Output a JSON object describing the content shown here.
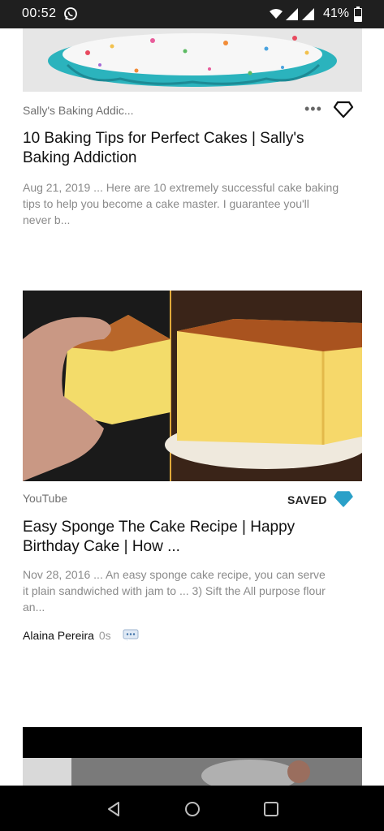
{
  "status_bar": {
    "time": "00:52",
    "battery": "41%",
    "battery_level": 0.41
  },
  "results": [
    {
      "source": "Sally's Baking Addic...",
      "title": "10 Baking Tips for Perfect Cakes | Sally's Baking Addiction",
      "snippet": "Aug 21, 2019 ... Here are 10 extremely successful cake baking tips to help you become a cake master. I guarantee you'll never b..."
    },
    {
      "source": "YouTube",
      "saved_label": "SAVED",
      "title": "Easy Sponge The Cake Recipe | Happy Birthday Cake | How ...",
      "snippet": "Nov 28, 2016 ... An easy sponge cake recipe, you can serve it plain sandwiched with jam to ... 3) Sift the All purpose flour an...",
      "author": "Alaina Pereira",
      "author_time": "0s"
    }
  ],
  "colors": {
    "saved_diamond": "#2aa0c8",
    "status_bar": "#1f1f1f"
  }
}
